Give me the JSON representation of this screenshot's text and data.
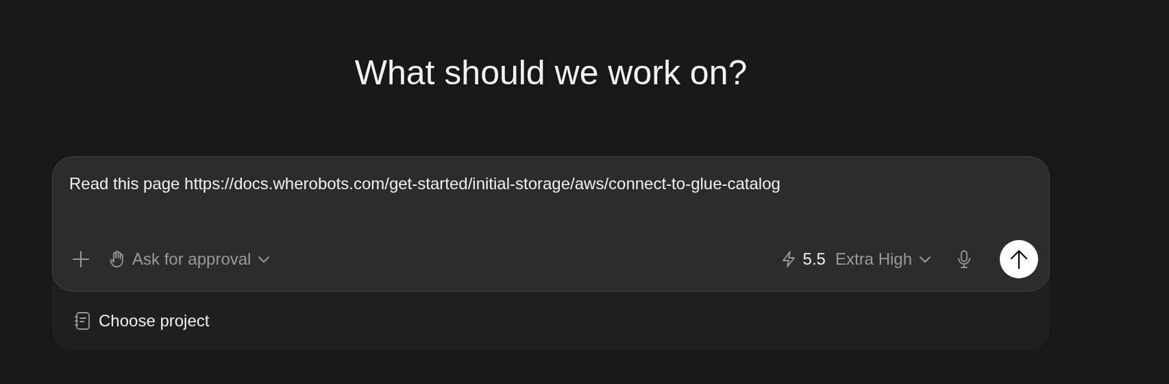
{
  "heading": "What should we work on?",
  "composer": {
    "value": "Read this page https://docs.wherobots.com/get-started/initial-storage/aws/connect-to-glue-catalog",
    "approval": "Ask for approval",
    "model": "5.5",
    "effort": "Extra High"
  },
  "project": {
    "label": "Choose project"
  }
}
